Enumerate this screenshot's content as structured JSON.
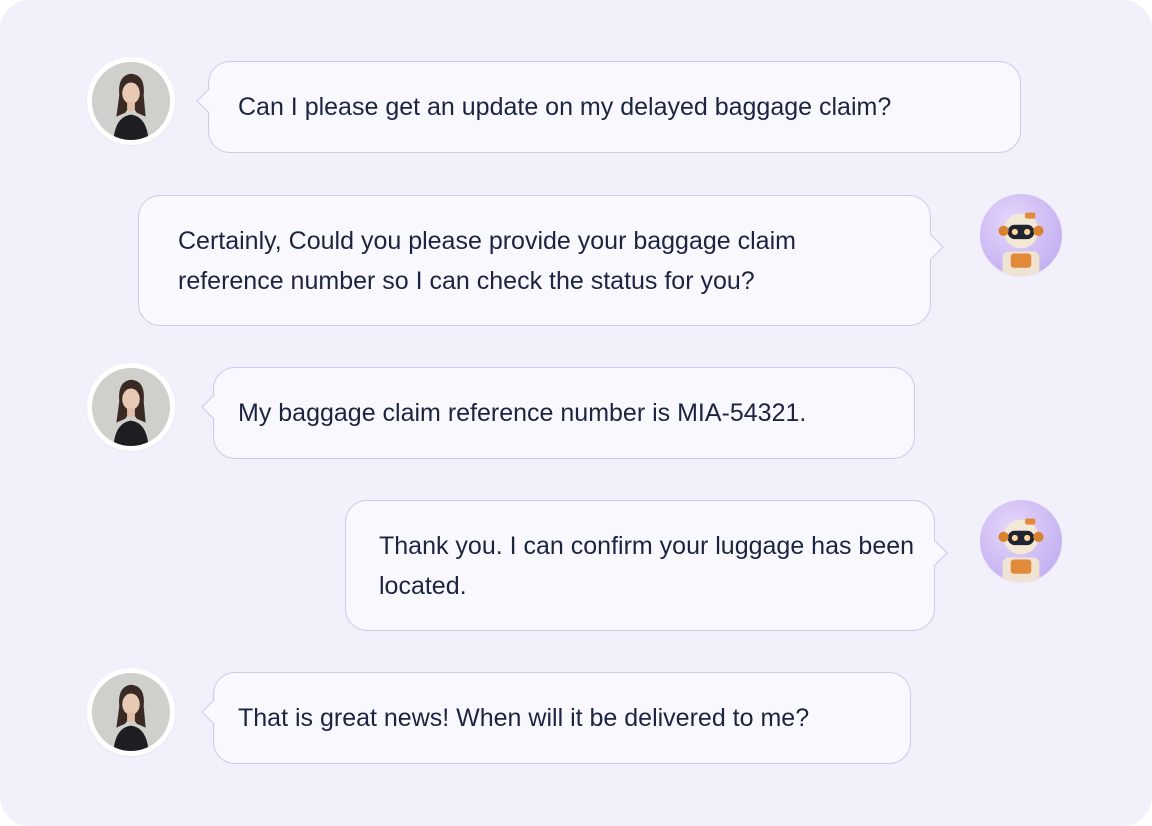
{
  "messages": [
    {
      "sender": "user",
      "text": "Can I please get an update on my delayed baggage claim?"
    },
    {
      "sender": "bot",
      "text": "Certainly, Could you please provide your baggage claim reference number so I can check the status for you?"
    },
    {
      "sender": "user",
      "text": "My baggage claim reference number is MIA-54321."
    },
    {
      "sender": "bot",
      "text": "Thank you. I can confirm your luggage has been located."
    },
    {
      "sender": "user",
      "text": "That is great news! When will it be delivered to me?"
    }
  ],
  "avatars": {
    "user": "user-avatar-photo",
    "bot": "robot-avatar"
  },
  "colors": {
    "background": "#f1f0fb",
    "bubble": "#f8f8fe",
    "bubble_border": "#c8cbec",
    "text": "#1c2440"
  }
}
